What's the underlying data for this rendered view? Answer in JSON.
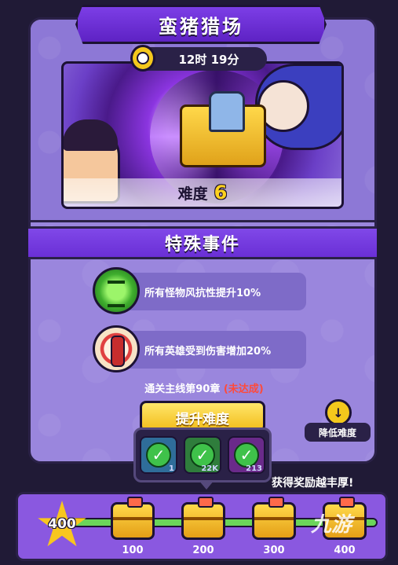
{
  "title": "蛮猪猎场",
  "timer": {
    "text": "12时 19分"
  },
  "difficulty": {
    "label": "难度",
    "value": "6"
  },
  "events": {
    "header": "特殊事件",
    "items": [
      {
        "icon": "wind-tornado-icon",
        "text": "所有怪物风抗性提升10%"
      },
      {
        "icon": "damage-pill-icon",
        "text": "所有英雄受到伤害增加20%"
      }
    ]
  },
  "unlock": {
    "condition": "通关主线第90章",
    "status": "(未达成)"
  },
  "buttons": {
    "raise": "提升难度",
    "lower": "降低难度"
  },
  "tooltip": {
    "tiles": [
      {
        "icon": "check-icon",
        "value": "1"
      },
      {
        "icon": "check-icon",
        "value": "22K"
      },
      {
        "icon": "check-icon",
        "value": "213"
      }
    ]
  },
  "rewards": {
    "label": "获得奖励越丰厚!",
    "current": "400",
    "milestones": [
      "100",
      "200",
      "300",
      "400"
    ]
  },
  "watermark": "九游",
  "colors": {
    "accent_purple": "#7c3ee6",
    "gold": "#f4c81c",
    "progress_green": "#6bd45a",
    "warning_red": "#ff4a3a"
  }
}
